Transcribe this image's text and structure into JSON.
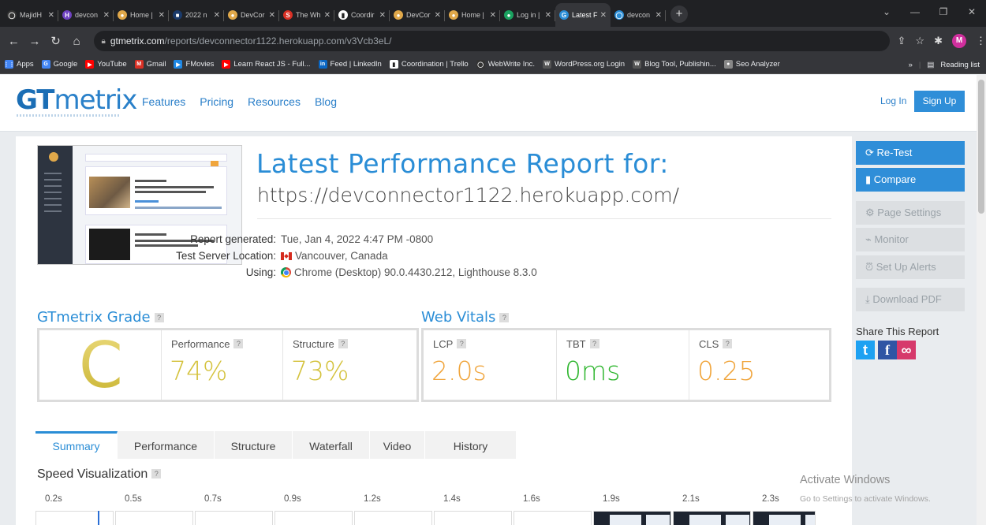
{
  "browser": {
    "tabs": [
      {
        "label": "MajidH",
        "color": "#333333",
        "glyph": "◯"
      },
      {
        "label": "devcon",
        "color": "#6f42c1",
        "glyph": "H"
      },
      {
        "label": "Home |",
        "color": "#e0a84a",
        "glyph": "●"
      },
      {
        "label": "2022 n",
        "color": "#1a3a6b",
        "glyph": "■"
      },
      {
        "label": "DevCor",
        "color": "#e0a84a",
        "glyph": "●"
      },
      {
        "label": "The Wh",
        "color": "#d93025",
        "glyph": "S"
      },
      {
        "label": "Coordir",
        "color": "#ffffff",
        "glyph": "▮"
      },
      {
        "label": "DevCor",
        "color": "#e0a84a",
        "glyph": "●"
      },
      {
        "label": "Home |",
        "color": "#e0a84a",
        "glyph": "●"
      },
      {
        "label": "Log in |",
        "color": "#1aa260",
        "glyph": "●"
      },
      {
        "label": "Latest F",
        "color": "#2a8dd6",
        "glyph": "G",
        "active": true
      },
      {
        "label": "devcon",
        "color": "#2a8dd6",
        "glyph": "◯"
      }
    ],
    "url_host": "gtmetrix.com",
    "url_path": "/reports/devconnector1122.herokuapp.com/v3Vcb3eL/",
    "profile_initial": "M",
    "bookmarks": [
      {
        "label": "Apps",
        "color": "#4285f4",
        "glyph": "⋮⋮"
      },
      {
        "label": "Google",
        "color": "#4285f4",
        "glyph": "G"
      },
      {
        "label": "YouTube",
        "color": "#ff0000",
        "glyph": "▶"
      },
      {
        "label": "Gmail",
        "color": "#d93025",
        "glyph": "M"
      },
      {
        "label": "FMovies",
        "color": "#1e88e5",
        "glyph": "▶"
      },
      {
        "label": "Learn React JS - Full...",
        "color": "#ff0000",
        "glyph": "▶"
      },
      {
        "label": "Feed | LinkedIn",
        "color": "#0a66c2",
        "glyph": "in"
      },
      {
        "label": "Coordination | Trello",
        "color": "#ffffff",
        "glyph": "▮"
      },
      {
        "label": "WebWrite Inc.",
        "color": "#333333",
        "glyph": "◯"
      },
      {
        "label": "WordPress.org Login",
        "color": "#555555",
        "glyph": "W"
      },
      {
        "label": "Blog Tool, Publishin...",
        "color": "#555555",
        "glyph": "W"
      },
      {
        "label": "Seo Analyzer",
        "color": "#888888",
        "glyph": "●"
      }
    ],
    "reading_list": "Reading list",
    "more_bookmarks": "»"
  },
  "site": {
    "logo_gt": "GT",
    "logo_metrix": "metrix",
    "nav": [
      "Features",
      "Pricing",
      "Resources",
      "Blog"
    ],
    "login": "Log In",
    "signup": "Sign Up"
  },
  "report": {
    "title": "Latest Performance Report for:",
    "url": "https://devconnector1122.herokuapp.com/",
    "generated_label": "Report generated:",
    "generated_value": "Tue, Jan 4, 2022 4:47 PM -0800",
    "server_label": "Test Server Location:",
    "server_value": "Vancouver, Canada",
    "using_label": "Using:",
    "using_value": "Chrome (Desktop) 90.0.4430.212, Lighthouse 8.3.0"
  },
  "grade": {
    "heading": "GTmetrix Grade",
    "letter": "C",
    "performance_label": "Performance",
    "performance_value": "74%",
    "structure_label": "Structure",
    "structure_value": "73%",
    "color": "#d4c23c"
  },
  "vitals": {
    "heading": "Web Vitals",
    "lcp_label": "LCP",
    "lcp_value": "2.0s",
    "lcp_color": "#f0a53c",
    "tbt_label": "TBT",
    "tbt_value": "0ms",
    "tbt_color": "#2fb62f",
    "cls_label": "CLS",
    "cls_value": "0.25",
    "cls_color": "#f0a53c"
  },
  "tabs": [
    "Summary",
    "Performance",
    "Structure",
    "Waterfall",
    "Video",
    "History"
  ],
  "active_tab": "Summary",
  "speed": {
    "heading": "Speed Visualization",
    "times": [
      "0.2s",
      "0.5s",
      "0.7s",
      "0.9s",
      "1.2s",
      "1.4s",
      "1.6s",
      "1.9s",
      "2.1s",
      "2.3s"
    ]
  },
  "sidebar": {
    "retest": "Re-Test",
    "compare": "Compare",
    "page_settings": "Page Settings",
    "monitor": "Monitor",
    "alerts": "Set Up Alerts",
    "download_pdf": "Download PDF",
    "share_label": "Share This Report"
  },
  "activation": {
    "title": "Activate Windows",
    "subtitle": "Go to Settings to activate Windows."
  }
}
